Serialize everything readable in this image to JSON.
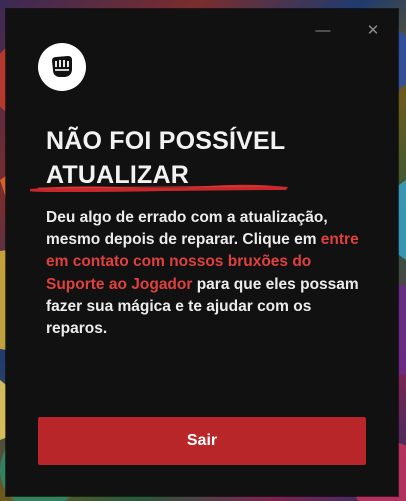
{
  "window": {
    "minimize_icon": "minimize-icon",
    "close_icon": "close-icon",
    "minimize_glyph": "—",
    "close_glyph": "✕"
  },
  "logo": {
    "icon": "riot-fist-logo"
  },
  "dialog": {
    "title_line1": "NÃO FOI POSSÍVEL",
    "title_line2": "ATUALIZAR",
    "body_before": "Deu algo de errado com a atualização, mesmo depois de reparar. Clique em ",
    "body_link": "entre em contato com nossos bruxões do Suporte ao Jogador",
    "body_after": " para que eles possam fazer sua mágica e te ajudar com os reparos.",
    "exit_label": "Sair"
  },
  "colors": {
    "dialog_bg": "#111111",
    "accent_red": "#b8262a",
    "link_red": "#e0403e",
    "text": "#ececec"
  }
}
